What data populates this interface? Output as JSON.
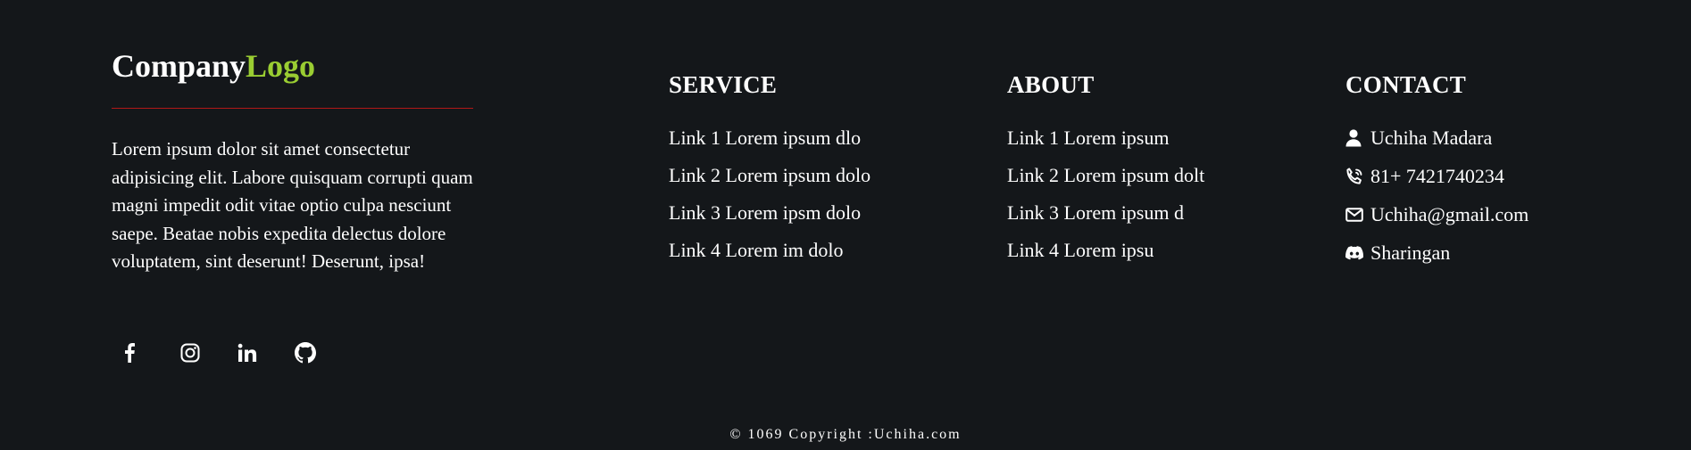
{
  "brand": {
    "logo_main": "Company",
    "logo_accent": "Logo",
    "description": "Lorem ipsum dolor sit amet consectetur adipisicing elit. Labore quisquam corrupti quam magni impedit odit vitae optio culpa nesciunt saepe. Beatae nobis expedita delectus dolore voluptatem, sint deserunt! Deserunt, ipsa!",
    "accent_color": "#9acd32",
    "divider_color": "#b01818"
  },
  "socials": [
    {
      "icon": "facebook-icon"
    },
    {
      "icon": "instagram-icon"
    },
    {
      "icon": "linkedin-icon"
    },
    {
      "icon": "github-icon"
    }
  ],
  "service": {
    "heading": "SERVICE",
    "links": [
      "Link 1 Lorem ipsum dlo",
      "Link 2 Lorem ipsum dolo",
      "Link 3 Lorem ipsm dolo",
      "Link 4 Lorem im dolo"
    ]
  },
  "about": {
    "heading": "ABOUT",
    "links": [
      "Link 1 Lorem ipsum",
      "Link 2 Lorem ipsum dolt",
      "Link 3 Lorem ipsum d",
      "Link 4 Lorem ipsu"
    ]
  },
  "contact": {
    "heading": "CONTACT",
    "items": [
      {
        "icon": "user-icon",
        "text": "Uchiha Madara"
      },
      {
        "icon": "phone-icon",
        "text": "81+ 7421740234"
      },
      {
        "icon": "envelope-icon",
        "text": "Uchiha@gmail.com"
      },
      {
        "icon": "discord-icon",
        "text": "Sharingan"
      }
    ]
  },
  "copyright": "© 1069 Copyright :Uchiha.com",
  "colors": {
    "background": "#14171a",
    "text": "#ffffff"
  }
}
